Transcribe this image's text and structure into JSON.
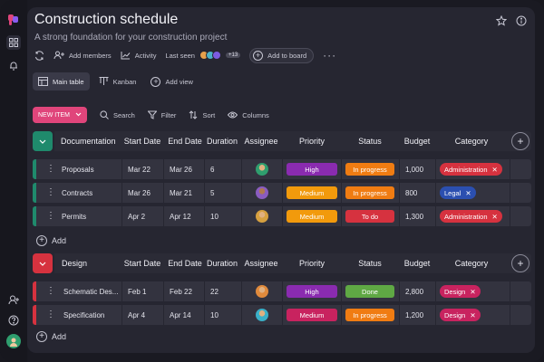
{
  "project": {
    "title": "Construction schedule",
    "subtitle": "A strong foundation for your construction project"
  },
  "toolbar": {
    "add_members": "Add members",
    "activity": "Activity",
    "last_seen": "Last seen",
    "last_seen_count": "+13",
    "add_to_board": "Add to board"
  },
  "views": {
    "main_table": "Main table",
    "kanban": "Kanban",
    "add_view": "Add view"
  },
  "actions": {
    "new_item": "NEW ITEM",
    "search": "Search",
    "filter": "Filter",
    "sort": "Sort",
    "columns": "Columns"
  },
  "columns": {
    "start_date": "Start Date",
    "end_date": "End Date",
    "duration": "Duration",
    "assignee": "Assignee",
    "priority": "Priority",
    "status": "Status",
    "budget": "Budget",
    "category": "Category"
  },
  "add_label": "Add",
  "colors": {
    "accent": "#e0457b",
    "documentation": "#1f8a6c",
    "design": "#d6323f",
    "high": "#8a2bb0",
    "medium": "#f29a0c",
    "in_progress": "#f07c12",
    "to_do": "#d6323f",
    "done": "#5fa844",
    "administration": "#d6323f",
    "legal": "#2b4fb0",
    "design_tag": "#c8235f"
  },
  "groups": [
    {
      "name": "Documentation",
      "rows": [
        {
          "name": "Proposals",
          "start": "Mar 22",
          "end": "Mar 26",
          "duration": "6",
          "priority": "High",
          "status": "In progress",
          "budget": "1,000",
          "category": "Administration"
        },
        {
          "name": "Contracts",
          "start": "Mar 26",
          "end": "Mar 21",
          "duration": "5",
          "priority": "Medium",
          "status": "In progress",
          "budget": "800",
          "category": "Legal"
        },
        {
          "name": "Permits",
          "start": "Apr 2",
          "end": "Apr 12",
          "duration": "10",
          "priority": "Medium",
          "status": "To do",
          "budget": "1,300",
          "category": "Administration"
        }
      ]
    },
    {
      "name": "Design",
      "rows": [
        {
          "name": "Schematic Des...",
          "start": "Feb 1",
          "end": "Feb 22",
          "duration": "22",
          "priority": "High",
          "status": "Done",
          "budget": "2,800",
          "category": "Design"
        },
        {
          "name": "Specification",
          "start": "Apr 4",
          "end": "Apr 14",
          "duration": "10",
          "priority": "Medium",
          "status": "In progress",
          "budget": "1,200",
          "category": "Design"
        }
      ]
    }
  ]
}
